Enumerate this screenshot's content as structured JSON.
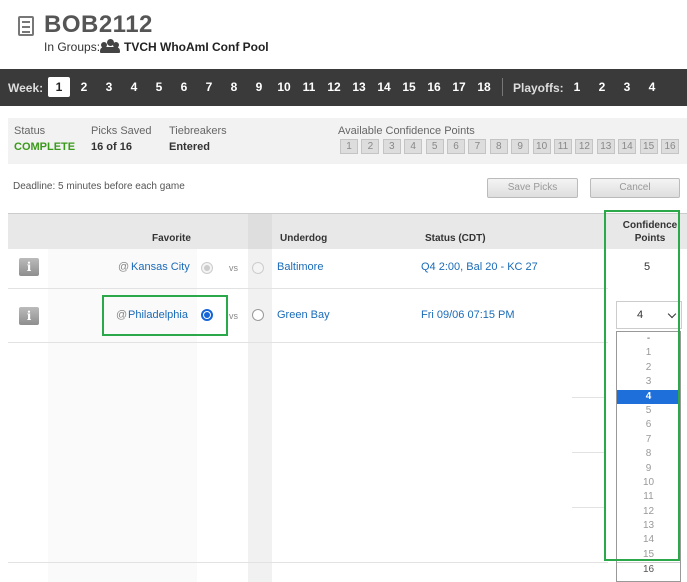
{
  "header": {
    "title": "BOB2112",
    "groups_label": "In Groups:",
    "group_name": "TVCH WhoAmI Conf Pool"
  },
  "weekbar": {
    "week_label": "Week:",
    "weeks": [
      "1",
      "2",
      "3",
      "4",
      "5",
      "6",
      "7",
      "8",
      "9",
      "10",
      "11",
      "12",
      "13",
      "14",
      "15",
      "16",
      "17",
      "18"
    ],
    "selected_week": "1",
    "playoffs_label": "Playoffs:",
    "playoffs": [
      "1",
      "2",
      "3",
      "4"
    ]
  },
  "status_panel": {
    "status_label": "Status",
    "status_value": "COMPLETE",
    "picks_label": "Picks Saved",
    "picks_value": "16 of 16",
    "tiebreakers_label": "Tiebreakers",
    "tiebreakers_value": "Entered",
    "available_label": "Available Confidence Points",
    "available_points": [
      "1",
      "2",
      "3",
      "4",
      "5",
      "6",
      "7",
      "8",
      "9",
      "10",
      "11",
      "12",
      "13",
      "14",
      "15",
      "16"
    ]
  },
  "actions": {
    "deadline": "Deadline: 5 minutes before each game",
    "save_label": "Save Picks",
    "cancel_label": "Cancel"
  },
  "table": {
    "headers": {
      "favorite": "Favorite",
      "underdog": "Underdog",
      "status": "Status (CDT)",
      "confidence": "Confidence Points"
    },
    "vs": "vs",
    "rows": [
      {
        "favorite": "Kansas City",
        "underdog": "Baltimore",
        "status": "Q4 2:00, Bal 20 - KC 27",
        "points": "5",
        "pick": "favorite",
        "locked": true
      },
      {
        "favorite": "Philadelphia",
        "underdog": "Green Bay",
        "status": "Fri 09/06 07:15 PM",
        "points": "4",
        "pick": "favorite",
        "locked": false
      }
    ]
  },
  "dropdown": {
    "selected": "4",
    "options": [
      "-",
      "1",
      "2",
      "3",
      "4",
      "5",
      "6",
      "7",
      "8",
      "9",
      "10",
      "11",
      "12",
      "13",
      "14",
      "15",
      "16"
    ]
  },
  "colors": {
    "accent_green": "#3a9a1a",
    "link_blue": "#1a6bb8",
    "highlight_green": "#2aa84a",
    "select_blue": "#1e6fd9",
    "weekbar_bg": "#3a3a3a"
  }
}
